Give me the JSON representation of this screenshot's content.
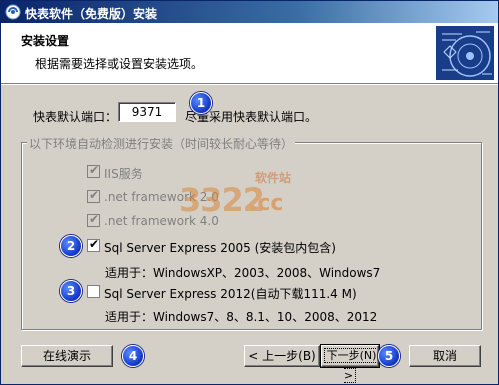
{
  "window": {
    "title": "快表软件（免费版）安装"
  },
  "header": {
    "title": "安装设置",
    "subtitle": "根据需要选择或设置安装选项。"
  },
  "port": {
    "label": "快表默认端口：",
    "value": "9371",
    "hint": "尽量采用快表默认端口。"
  },
  "group": {
    "legend": "以下环境自动检测进行安装（时间较长耐心等待）",
    "items": [
      {
        "label": "IIS服务",
        "checked": true,
        "disabled": true
      },
      {
        "label": ".net framework 2.0",
        "checked": true,
        "disabled": true
      },
      {
        "label": ".net framework 4.0",
        "checked": true,
        "disabled": true
      },
      {
        "label": "Sql Server Express 2005 (安装包内包含)",
        "checked": true,
        "disabled": false
      },
      {
        "label": "Sql Server Express 2012(自动下载111.4 M)",
        "checked": false,
        "disabled": false
      }
    ],
    "notes": [
      "适用于：WindowsXP、2003、2008、Windows7",
      "适用于：Windows7、8、8.1、10、2008、2012"
    ]
  },
  "buttons": {
    "demo": "在线演示",
    "back": "< 上一步(B)",
    "next": "下一步(N) >",
    "cancel": "取消"
  },
  "badges": [
    "1",
    "2",
    "3",
    "4",
    "5"
  ],
  "watermark": {
    "main": "3322",
    "suffix": ".cc",
    "tag": "软件站"
  },
  "colors": {
    "titlebar_start": "#0a246a",
    "titlebar_end": "#a6caf0",
    "face": "#d4d0c8",
    "badge": "#1035c8"
  }
}
